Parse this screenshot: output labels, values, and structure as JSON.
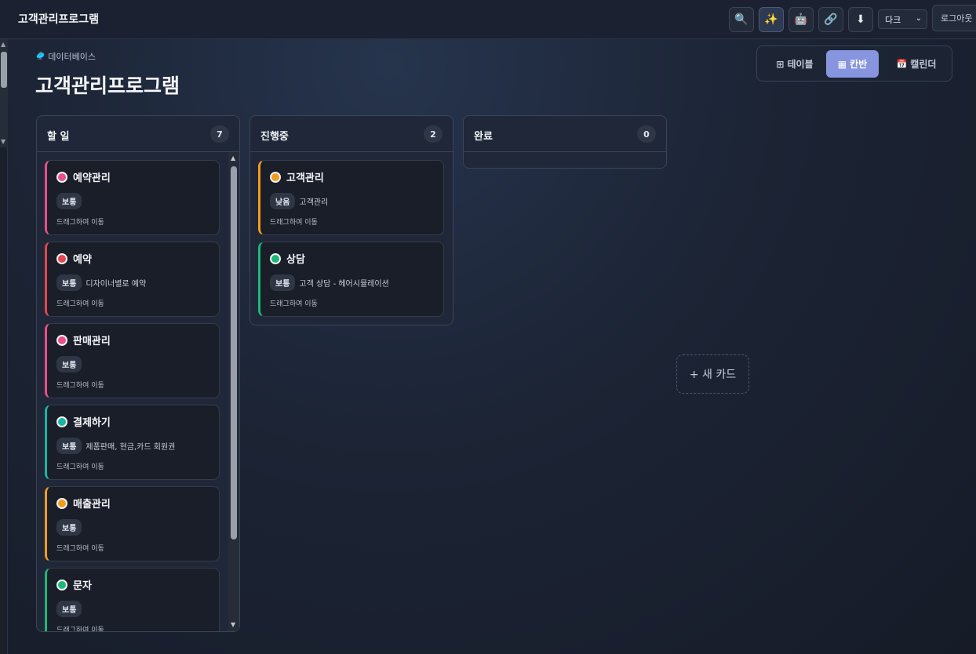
{
  "app": {
    "title": "고객관리프로그램"
  },
  "toolbar": {
    "buttons": [
      {
        "name": "search-button",
        "icon": "🔍"
      },
      {
        "name": "ai-sparkle-button",
        "icon": "✨"
      },
      {
        "name": "robot-button",
        "icon": "🤖"
      },
      {
        "name": "link-button",
        "icon": "🔗"
      },
      {
        "name": "download-button",
        "icon": "⬇"
      }
    ],
    "theme_select": "다크",
    "logout_label": "로그아웃"
  },
  "header": {
    "breadcrumb": "데이터베이스",
    "breadcrumb_icon": "🥏",
    "title": "고객관리프로그램"
  },
  "view_tabs": [
    {
      "icon": "⊞",
      "label": "테이블",
      "active": false
    },
    {
      "icon": "▦",
      "label": "칸반",
      "active": true
    },
    {
      "icon": "📅",
      "label": "캘린더",
      "active": false
    }
  ],
  "columns": [
    {
      "title": "할 일",
      "count": "7",
      "cards": [
        {
          "title": "예약관리",
          "dot": "#e94f8a",
          "accent": "#e94f8a",
          "badge": "보통",
          "desc": "",
          "hint": "드래그하여 이동"
        },
        {
          "title": "예약",
          "dot": "#e2484f",
          "accent": "#e2484f",
          "badge": "보통",
          "desc": "디자이너별로 예약",
          "hint": "드래그하여 이동"
        },
        {
          "title": "판매관리",
          "dot": "#e94f8a",
          "accent": "#e94f8a",
          "badge": "보통",
          "desc": "",
          "hint": "드래그하여 이동"
        },
        {
          "title": "결제하기",
          "dot": "#1ab5a4",
          "accent": "#1ab5a4",
          "badge": "보통",
          "desc": "제품판매, 현금,카드 회원권",
          "hint": "드래그하여 이동"
        },
        {
          "title": "매출관리",
          "dot": "#f29c1f",
          "accent": "#f29c1f",
          "badge": "보통",
          "desc": "",
          "hint": "드래그하여 이동"
        },
        {
          "title": "문자",
          "dot": "#1fb67a",
          "accent": "#1fb67a",
          "badge": "보통",
          "desc": "",
          "hint": "드래그하여 이동"
        }
      ]
    },
    {
      "title": "진행중",
      "count": "2",
      "cards": [
        {
          "title": "고객관리",
          "dot": "#f29c1f",
          "accent": "#f29c1f",
          "badge": "낮음",
          "desc": "고객관리",
          "hint": "드래그하여 이동"
        },
        {
          "title": "상담",
          "dot": "#1fb67a",
          "accent": "#1fb67a",
          "badge": "보통",
          "desc": "고객 상담 - 헤어시뮬레이션",
          "hint": "드래그하여 이동"
        }
      ]
    },
    {
      "title": "완료",
      "count": "0",
      "cards": []
    }
  ],
  "new_card_label": "+ 새 카드"
}
